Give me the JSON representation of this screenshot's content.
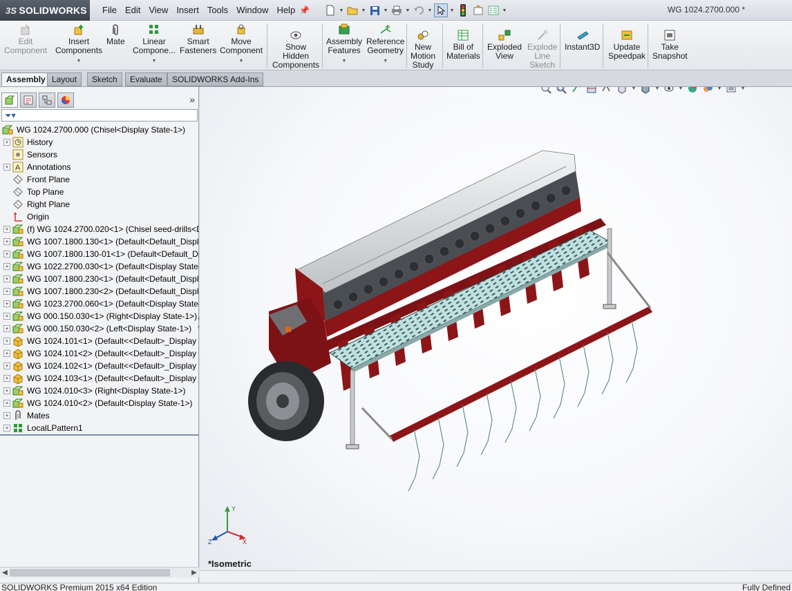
{
  "app": {
    "brand": "SOLIDWORKS",
    "document_title": "WG 1024.2700.000 *"
  },
  "menu": [
    "File",
    "Edit",
    "View",
    "Insert",
    "Tools",
    "Window",
    "Help"
  ],
  "commands": [
    {
      "line1": "Edit",
      "line2": "Component",
      "line3": "",
      "enabled": false,
      "dropdown": false
    },
    {
      "line1": "Insert",
      "line2": "Components",
      "line3": "",
      "enabled": true,
      "dropdown": true
    },
    {
      "line1": "Mate",
      "line2": "",
      "line3": "",
      "enabled": true,
      "dropdown": false
    },
    {
      "line1": "Linear",
      "line2": "Compone...",
      "line3": "",
      "enabled": true,
      "dropdown": true
    },
    {
      "line1": "Smart",
      "line2": "Fasteners",
      "line3": "",
      "enabled": true,
      "dropdown": false
    },
    {
      "line1": "Move",
      "line2": "Component",
      "line3": "",
      "enabled": true,
      "dropdown": true
    },
    {
      "line1": "Show",
      "line2": "Hidden",
      "line3": "Components",
      "enabled": true,
      "dropdown": false
    },
    {
      "line1": "Assembly",
      "line2": "Features",
      "line3": "",
      "enabled": true,
      "dropdown": true
    },
    {
      "line1": "Reference",
      "line2": "Geometry",
      "line3": "",
      "enabled": true,
      "dropdown": true
    },
    {
      "line1": "New",
      "line2": "Motion",
      "line3": "Study",
      "enabled": true,
      "dropdown": false
    },
    {
      "line1": "Bill of",
      "line2": "Materials",
      "line3": "",
      "enabled": true,
      "dropdown": false
    },
    {
      "line1": "Exploded",
      "line2": "View",
      "line3": "",
      "enabled": true,
      "dropdown": false
    },
    {
      "line1": "Explode",
      "line2": "Line",
      "line3": "Sketch",
      "enabled": false,
      "dropdown": false
    },
    {
      "line1": "Instant3D",
      "line2": "",
      "line3": "",
      "enabled": true,
      "dropdown": false
    },
    {
      "line1": "Update",
      "line2": "Speedpak",
      "line3": "",
      "enabled": true,
      "dropdown": false
    },
    {
      "line1": "Take",
      "line2": "Snapshot",
      "line3": "",
      "enabled": true,
      "dropdown": false
    }
  ],
  "tabs": [
    "Assembly",
    "Layout",
    "Sketch",
    "Evaluate",
    "SOLIDWORKS Add-Ins"
  ],
  "tree": [
    {
      "label": "WG 1024.2700.000  (Chisel<Display State-1>)",
      "icon": "assembly-icon",
      "expander": false,
      "root": true
    },
    {
      "label": "History",
      "icon": "history-icon",
      "expander": true
    },
    {
      "label": "Sensors",
      "icon": "sensor-icon",
      "expander": false
    },
    {
      "label": "Annotations",
      "icon": "annotations-icon",
      "expander": true
    },
    {
      "label": "Front Plane",
      "icon": "plane-icon",
      "expander": false
    },
    {
      "label": "Top Plane",
      "icon": "plane-icon",
      "expander": false
    },
    {
      "label": "Right Plane",
      "icon": "plane-icon",
      "expander": false
    },
    {
      "label": "Origin",
      "icon": "origin-icon",
      "expander": false
    },
    {
      "label": "(f) WG 1024.2700.020<1> (Chisel seed-drills<Di",
      "icon": "subassembly-icon",
      "expander": true
    },
    {
      "label": "WG 1007.1800.130<1> (Default<Default_Displa",
      "icon": "subassembly-icon",
      "expander": true
    },
    {
      "label": "WG 1007.1800.130-01<1> (Default<Default_Dis",
      "icon": "subassembly-icon",
      "expander": true
    },
    {
      "label": "WG 1022.2700.030<1> (Default<Display State-1",
      "icon": "subassembly-icon",
      "expander": true
    },
    {
      "label": "WG 1007.1800.230<1> (Default<Default_Displa",
      "icon": "subassembly-icon",
      "expander": true
    },
    {
      "label": "WG 1007.1800.230<2> (Default<Default_Displa",
      "icon": "subassembly-icon",
      "expander": true
    },
    {
      "label": "WG 1023.2700.060<1> (Default<Display State-1",
      "icon": "subassembly-icon",
      "expander": true
    },
    {
      "label": "WG 000.150.030<1> (Right<Display State-1>)",
      "icon": "subassembly-icon",
      "expander": true
    },
    {
      "label": "WG 000.150.030<2> (Left<Display State-1>)",
      "icon": "subassembly-icon",
      "expander": true
    },
    {
      "label": "WG 1024.101<1> (Default<<Default>_Display S",
      "icon": "part-icon",
      "expander": true
    },
    {
      "label": "WG 1024.101<2> (Default<<Default>_Display S",
      "icon": "part-icon",
      "expander": true
    },
    {
      "label": "WG 1024.102<1> (Default<<Default>_Display S",
      "icon": "part-icon",
      "expander": true
    },
    {
      "label": "WG 1024.103<1> (Default<<Default>_Display S",
      "icon": "part-icon",
      "expander": true
    },
    {
      "label": "WG 1024.010<3> (Right<Display State-1>)",
      "icon": "subassembly-icon",
      "expander": true
    },
    {
      "label": "WG 1024.010<2> (Default<Display State-1>)",
      "icon": "subassembly-icon",
      "expander": true
    },
    {
      "label": "Mates",
      "icon": "mates-icon",
      "expander": true
    },
    {
      "label": "LocalLPattern1",
      "icon": "pattern-icon",
      "expander": true
    }
  ],
  "viewport": {
    "view_name": "*Isometric",
    "triad": {
      "x": "X",
      "y": "Y",
      "z": "Z"
    }
  },
  "status": {
    "left": "SOLIDWORKS Premium 2015 x64 Edition",
    "right": "Fully Defined"
  },
  "colors": {
    "machine_red": "#8c1518",
    "hopper_gray": "#c9cbce",
    "platform_teal": "#bfe0e0",
    "tree_selection": "#2a5f99"
  }
}
